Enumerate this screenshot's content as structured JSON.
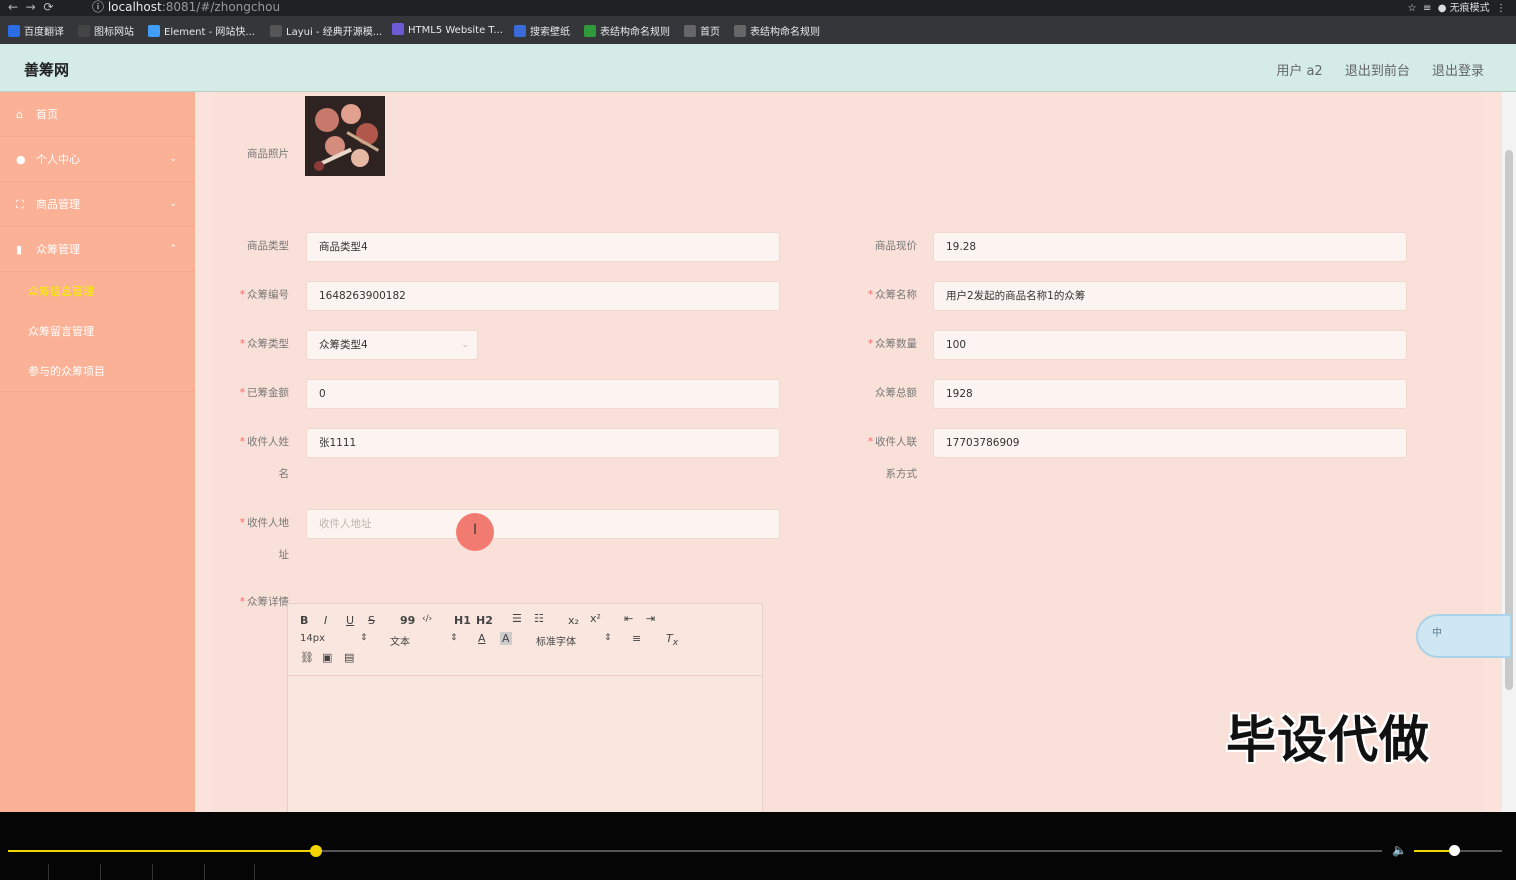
{
  "browser": {
    "url_host": "localhost",
    "url_rest": ":8081/#/zhongchou",
    "incognito_label": "无痕模式",
    "bookmarks": [
      {
        "label": "百度翻译",
        "color": "#2b6de6"
      },
      {
        "label": "图标网站",
        "color": "#444"
      },
      {
        "label": "Element - 网站快...",
        "color": "#409eff"
      },
      {
        "label": "Layui - 经典开源模...",
        "color": "#555"
      },
      {
        "label": "HTML5 Website T...",
        "color": "#6b5bd6"
      },
      {
        "label": "搜索壁纸",
        "color": "#3a6bd8"
      },
      {
        "label": "表结构命名规则",
        "color": "#2e9a3b"
      },
      {
        "label": "首页",
        "color": "#666"
      },
      {
        "label": "表结构命名规则",
        "color": "#666"
      }
    ]
  },
  "header": {
    "title": "善筹网",
    "user": "用户 a2",
    "to_front": "退出到前台",
    "logout": "退出登录"
  },
  "sidebar": {
    "items": [
      {
        "label": "首页",
        "icon": "home-icon"
      },
      {
        "label": "个人中心",
        "icon": "user-icon"
      },
      {
        "label": "商品管理",
        "icon": "grid-icon"
      },
      {
        "label": "众筹管理",
        "icon": "chart-icon"
      }
    ],
    "subitems": [
      "众筹信息管理",
      "众筹留言管理",
      "参与的众筹项目"
    ]
  },
  "form": {
    "photo_label": "商品照片",
    "product_type_label": "商品类型",
    "product_type_value": "商品类型4",
    "current_price_label": "商品现价",
    "current_price_value": "19.28",
    "crowd_no_label": "众筹编号",
    "crowd_no_value": "1648263900182",
    "crowd_name_label": "众筹名称",
    "crowd_name_value": "用户2发起的商品名称1的众筹",
    "crowd_type_label": "众筹类型",
    "crowd_type_value": "众筹类型4",
    "crowd_qty_label": "众筹数量",
    "crowd_qty_value": "100",
    "raised_label": "已筹金额",
    "raised_value": "0",
    "total_label": "众筹总额",
    "total_value": "1928",
    "recipient_name_label_1": "收件人姓",
    "recipient_name_label_2": "名",
    "recipient_name_value": "张1111",
    "recipient_phone_label_1": "收件人联",
    "recipient_phone_label_2": "系方式",
    "recipient_phone_value": "17703786909",
    "address_label_1": "收件人地",
    "address_label_2": "址",
    "address_placeholder": "收件人地址",
    "detail_label": "众筹详情"
  },
  "editor": {
    "bold": "B",
    "italic": "I",
    "underline": "U",
    "strike": "S",
    "quote": "99",
    "code": "‹/›",
    "h1": "H1",
    "h2": "H2",
    "sub": "x₂",
    "sup": "x²",
    "font_size": "14px",
    "format": "文本",
    "font_family": "标准字体"
  },
  "overlay": {
    "watermark": "毕设代做",
    "lang_badge": "中",
    "cursor_glyph": "I"
  },
  "player": {
    "progress": 0.224,
    "volume": 0.45
  }
}
